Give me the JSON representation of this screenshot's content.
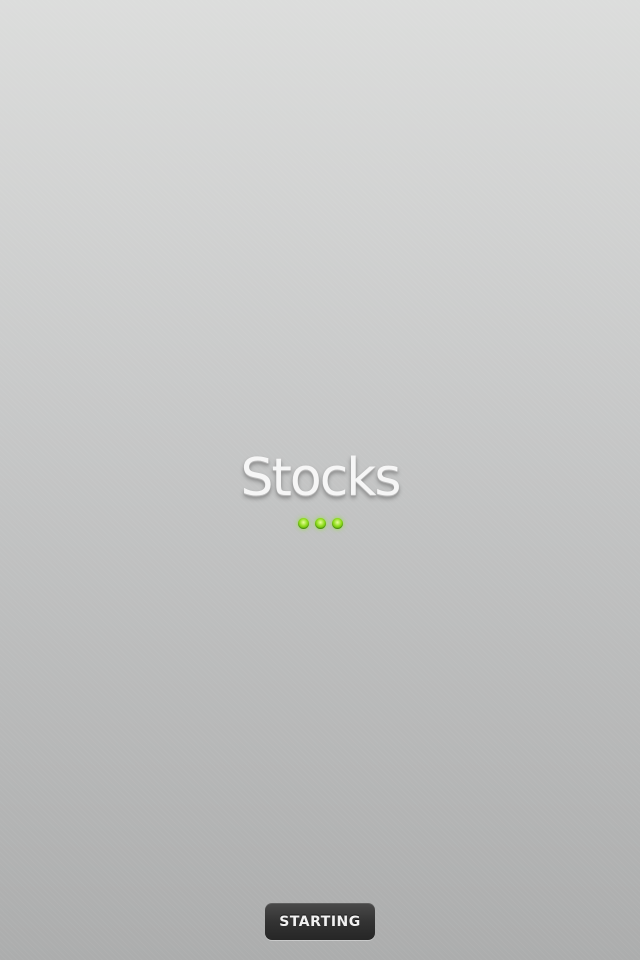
{
  "app": {
    "title": "Stocks"
  },
  "loading_indicator": {
    "dots": 3,
    "color": "#8fdc1c"
  },
  "status": {
    "label": "STARTING"
  },
  "colors": {
    "background_top": "#dcdddc",
    "background_bottom": "#acadad",
    "pill_background": "#333333"
  }
}
